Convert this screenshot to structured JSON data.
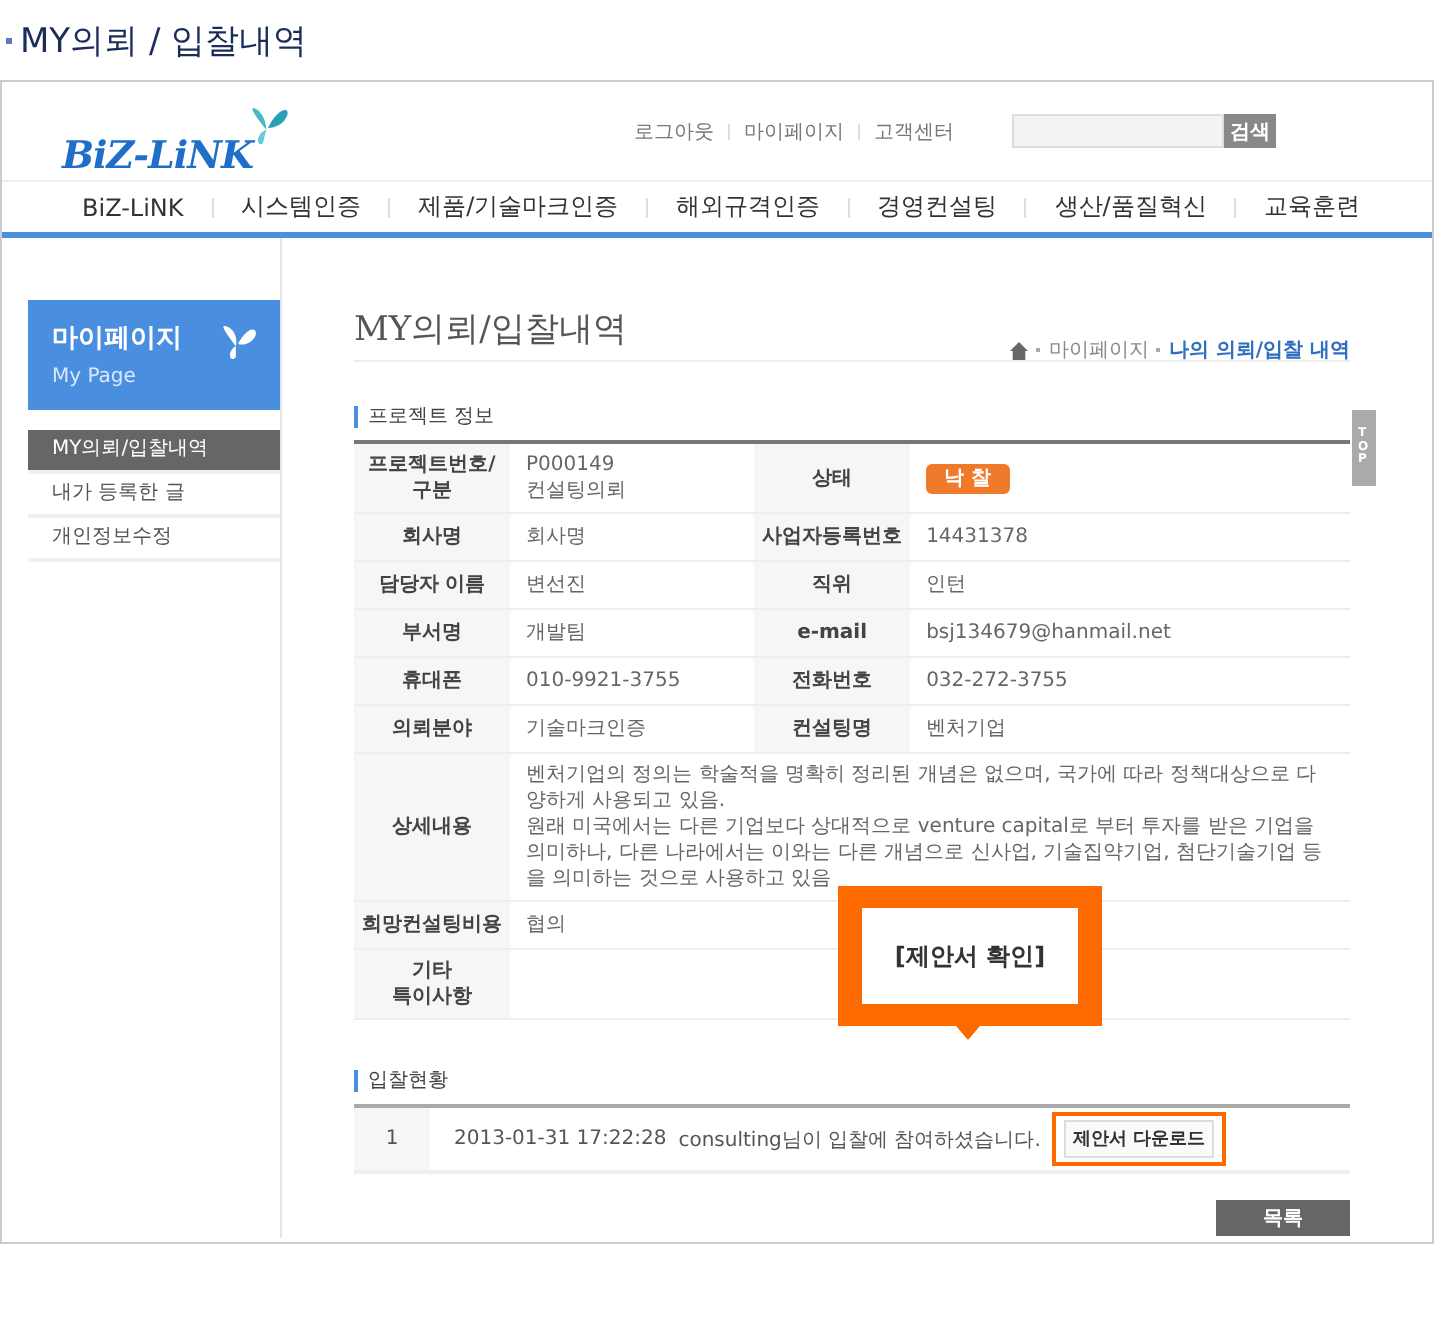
{
  "page_title": "MY의뢰 / 입찰내역",
  "header": {
    "logo": "BiZ-LiNK",
    "util_links": [
      "로그아웃",
      "마이페이지",
      "고객센터"
    ],
    "search": {
      "button": "검색"
    }
  },
  "nav": [
    "BiZ-LiNK",
    "시스템인증",
    "제품/기술마크인증",
    "해외규격인증",
    "경영컨설팅",
    "생산/품질혁신",
    "교육훈련"
  ],
  "sidebar": {
    "title": "마이페이지",
    "subtitle": "My Page",
    "items": [
      {
        "label": "MY의뢰/입찰내역",
        "selected": true
      },
      {
        "label": "내가 등록한 글",
        "selected": false
      },
      {
        "label": "개인정보수정",
        "selected": false
      }
    ]
  },
  "content": {
    "title": "MY의뢰/입찰내역",
    "breadcrumb": [
      "마이페이지",
      "나의 의뢰/입찰 내역"
    ],
    "top_tab": "TOP",
    "project_section": "프로젝트 정보",
    "rows": [
      {
        "cells": [
          {
            "label": "프로젝트번호/\n구분",
            "value": "P000149\n컨설팅의뢰",
            "kind": "text"
          },
          {
            "label": "상태",
            "value": "낙 찰",
            "kind": "badge"
          }
        ]
      },
      {
        "cells": [
          {
            "label": "회사명",
            "value": "회사명",
            "kind": "text"
          },
          {
            "label": "사업자등록번호",
            "value": "14431378",
            "kind": "text"
          }
        ]
      },
      {
        "cells": [
          {
            "label": "담당자 이름",
            "value": "변선진",
            "kind": "text"
          },
          {
            "label": "직위",
            "value": "인턴",
            "kind": "text"
          }
        ]
      },
      {
        "cells": [
          {
            "label": "부서명",
            "value": "개발팀",
            "kind": "text"
          },
          {
            "label": "e-mail",
            "value": "bsj134679@hanmail.net",
            "kind": "text"
          }
        ]
      },
      {
        "cells": [
          {
            "label": "휴대폰",
            "value": "010-9921-3755",
            "kind": "text"
          },
          {
            "label": "전화번호",
            "value": "032-272-3755",
            "kind": "text"
          }
        ]
      },
      {
        "cells": [
          {
            "label": "의뢰분야",
            "value": "기술마크인증",
            "kind": "text"
          },
          {
            "label": "컨설팅명",
            "value": "벤처기업",
            "kind": "text"
          }
        ]
      },
      {
        "cells": [
          {
            "label": "상세내용",
            "value": "벤처기업의 정의는 학술적을 명확히 정리된 개념은 없으며, 국가에 따라 정책대상으로 다양하게 사용되고 있음.\n원래 미국에서는 다른 기업보다 상대적으로 venture capital로 부터 투자를 받은 기업을 의미하나, 다른 나라에서는 이와는 다른 개념으로 신사업, 기술집약기업, 첨단기술기업 등을 의미하는 것으로 사용하고 있음",
            "kind": "text"
          }
        ]
      },
      {
        "cells": [
          {
            "label": "희망컨설팅비용",
            "value": "협의",
            "kind": "text"
          }
        ]
      },
      {
        "cells": [
          {
            "label": "기타\n특이사항",
            "kind": "text"
          }
        ]
      }
    ],
    "bid_section": "입찰현황",
    "bids": [
      {
        "no": "1",
        "datetime": "2013-01-31 17:22:28",
        "message": "consulting님이 입찰에 참여하셨습니다.",
        "button": "제안서 다운로드"
      }
    ],
    "callout": "[제안서 확인]",
    "list_button": "목록"
  }
}
